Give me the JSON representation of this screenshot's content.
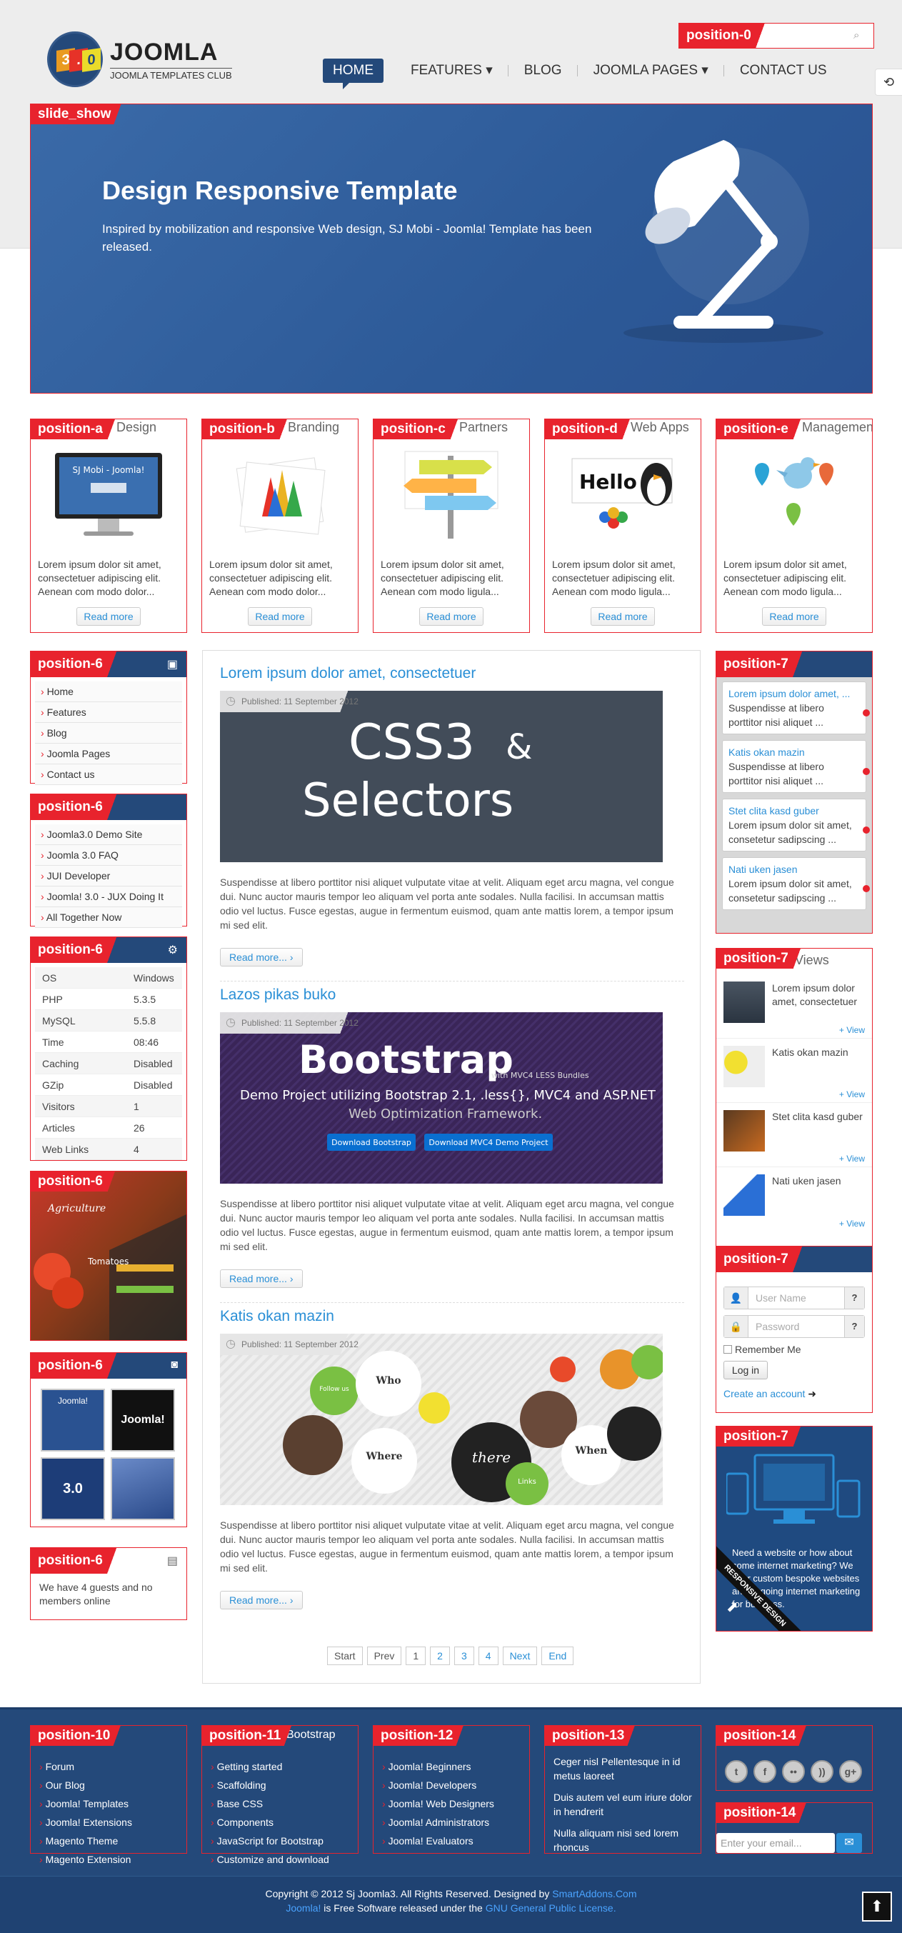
{
  "logo": {
    "cube_digits": [
      "3",
      ".",
      "0"
    ],
    "name": "JOOMLA",
    "tagline": "JOOMLA TEMPLATES CLUB"
  },
  "search": {
    "label": "position-0",
    "placeholder": ""
  },
  "nav": {
    "items": [
      "HOME",
      "FEATURES ▾",
      "BLOG",
      "JOOMLA PAGES ▾",
      "CONTACT US"
    ],
    "active": "HOME"
  },
  "slideshow": {
    "label": "slide_show",
    "title": "Design Responsive Template",
    "description": "Inspired by mobilization and responsive Web design, SJ Mobi - Joomla! Template has been released."
  },
  "features": [
    {
      "label": "position-a",
      "heading": "Design",
      "text": "Lorem ipsum dolor sit amet, consectetuer adipiscing elit. Aenean com modo dolor...",
      "button": "Read more",
      "screen_text": "SJ Mobi - Joomla!"
    },
    {
      "label": "position-b",
      "heading": "Branding",
      "text": "Lorem ipsum dolor sit amet, consectetuer adipiscing elit. Aenean com modo dolor...",
      "button": "Read more"
    },
    {
      "label": "position-c",
      "heading": "Partners",
      "text": "Lorem ipsum dolor sit amet, consectetuer adipiscing elit. Aenean com modo ligula...",
      "button": "Read more"
    },
    {
      "label": "position-d",
      "heading": "Web Apps",
      "text": "Lorem ipsum dolor sit amet, consectetuer adipiscing elit. Aenean com modo ligula...",
      "button": "Read more",
      "sign_text": "Hello"
    },
    {
      "label": "position-e",
      "heading": "Management",
      "text": "Lorem ipsum dolor sit amet, consectetuer adipiscing elit. Aenean com modo ligula...",
      "button": "Read more"
    }
  ],
  "left": {
    "menu1": {
      "label": "position-6",
      "items": [
        "Home",
        "Features",
        "Blog",
        "Joomla Pages",
        "Contact us"
      ]
    },
    "menu2": {
      "label": "position-6",
      "items": [
        "Joomla3.0 Demo Site",
        "Joomla 3.0 FAQ",
        "JUI Developer",
        "Joomla! 3.0 - JUX Doing It",
        "All Together Now"
      ]
    },
    "stats": {
      "label": "position-6",
      "rows": [
        [
          "OS",
          "Windows"
        ],
        [
          "PHP",
          "5.3.5"
        ],
        [
          "MySQL",
          "5.5.8"
        ],
        [
          "Time",
          "08:46"
        ],
        [
          "Caching",
          "Disabled"
        ],
        [
          "GZip",
          "Disabled"
        ],
        [
          "Visitors",
          "1"
        ],
        [
          "Articles",
          "26"
        ],
        [
          "Web Links",
          "4"
        ]
      ]
    },
    "banner": {
      "label": "position-6",
      "brand": "Agriculture",
      "sign": "Tomatoes"
    },
    "gallery": {
      "label": "position-6",
      "captions": [
        "Joomla!",
        "Joomla!",
        "3.0",
        ""
      ]
    },
    "online": {
      "label": "position-6",
      "text": "We have 4 guests and no members online"
    }
  },
  "articles": [
    {
      "title": "Lorem ipsum dolor amet, consectetuer",
      "published": "Published: 11 September 2012",
      "image_text": [
        "CSS3",
        "&",
        "Selectors"
      ],
      "text": "Suspendisse at libero porttitor nisi aliquet vulputate vitae at velit. Aliquam eget arcu magna, vel congue dui. Nunc auctor mauris tempor leo aliquam vel porta ante sodales. Nulla facilisi. In accumsan mattis odio vel luctus. Fusce egestas, augue in fermentum euismod, quam ante mattis lorem, a tempor ipsum mi sed elit.",
      "readmore": "Read more..."
    },
    {
      "title": "Lazos pikas buko",
      "published": "Published: 11 September 2012",
      "image_text": [
        "Bootstrap",
        "with MVC4 LESS Bundles",
        "Demo Project utilizing Bootstrap 2.1, .less{}, MVC4 and ASP.NET",
        "Web Optimization Framework.",
        "Download Bootstrap",
        "Download MVC4 Demo Project"
      ],
      "text": "Suspendisse at libero porttitor nisi aliquet vulputate vitae at velit. Aliquam eget arcu magna, vel congue dui. Nunc auctor mauris tempor leo aliquam vel porta ante sodales. Nulla facilisi. In accumsan mattis odio vel luctus. Fusce egestas, augue in fermentum euismod, quam ante mattis lorem, a tempor ipsum mi sed elit.",
      "readmore": "Read more..."
    },
    {
      "title": "Katis okan mazin",
      "published": "Published: 11 September 2012",
      "image_text": [
        "Who",
        "Where",
        "When",
        "there",
        "Links",
        "Follow us"
      ],
      "text": "Suspendisse at libero porttitor nisi aliquet vulputate vitae at velit. Aliquam eget arcu magna, vel congue dui. Nunc auctor mauris tempor leo aliquam vel porta ante sodales. Nulla facilisi. In accumsan mattis odio vel luctus. Fusce egestas, augue in fermentum euismod, quam ante mattis lorem, a tempor ipsum mi sed elit.",
      "readmore": "Read more..."
    }
  ],
  "pager": [
    "Start",
    "Prev",
    "1",
    "2",
    "3",
    "4",
    "Next",
    "End"
  ],
  "right": {
    "slider": {
      "label": "position-7",
      "items": [
        {
          "title": "Lorem ipsum dolor amet, ...",
          "text": "Suspendisse at libero porttitor nisi aliquet ..."
        },
        {
          "title": "Katis okan mazin",
          "text": "Suspendisse at libero porttitor nisi aliquet ..."
        },
        {
          "title": "Stet clita kasd guber",
          "text": "Lorem ipsum dolor sit amet, consetetur sadipscing ..."
        },
        {
          "title": "Nati uken jasen",
          "text": "Lorem ipsum dolor sit amet, consetetur sadipscing ..."
        }
      ]
    },
    "news": {
      "label": "position-7",
      "heading": "Views",
      "items": [
        {
          "title": "Lorem ipsum dolor amet, consectetuer",
          "view": "+ View"
        },
        {
          "title": "Katis okan mazin",
          "view": "+ View"
        },
        {
          "title": "Stet clita kasd guber",
          "view": "+ View"
        },
        {
          "title": "Nati uken jasen",
          "view": "+ View"
        }
      ]
    },
    "login": {
      "label": "position-7",
      "username_placeholder": "User Name",
      "password_placeholder": "Password",
      "remember": "Remember Me",
      "button": "Log in",
      "create": "Create an account"
    },
    "promo": {
      "label": "position-7",
      "text": "Need a website or how about some internet marketing? We offer custom bespoke websites and ongoing internet marketing for business.",
      "ribbon": "RESPONSIVE DESIGN"
    }
  },
  "footer": {
    "col1": {
      "label": "position-10",
      "items": [
        "Forum",
        "Our Blog",
        "Joomla! Templates",
        "Joomla! Extensions",
        "Magento Theme",
        "Magento Extension"
      ]
    },
    "col2": {
      "label": "position-11",
      "heading": "Bootstrap",
      "items": [
        "Getting started",
        "Scaffolding",
        "Base CSS",
        "Components",
        "JavaScript for Bootstrap",
        "Customize and download"
      ]
    },
    "col3": {
      "label": "position-12",
      "items": [
        "Joomla! Beginners",
        "Joomla! Developers",
        "Joomla! Web Designers",
        "Joomla! Administrators",
        "Joomla! Evaluators"
      ]
    },
    "col4": {
      "label": "position-13",
      "texts": [
        "Ceger nisl Pellentesque in id metus laoreet",
        "Duis autem vel eum iriure dolor in hendrerit",
        "Nulla aliquam nisi sed lorem rhoncus"
      ]
    },
    "col5": {
      "label": "position-14",
      "social": [
        "t",
        "f",
        "••",
        "))",
        "g+"
      ]
    },
    "newsletter": {
      "label": "position-14",
      "placeholder": "Enter your email..."
    }
  },
  "copyright": {
    "line1_pre": "Copyright © 2012 Sj Joomla3. All Rights Reserved. Designed by",
    "line1_link": "SmartAddons.Com",
    "line2_link1": "Joomla!",
    "line2_mid": "is Free Software released under the",
    "line2_link2": "GNU General Public License."
  },
  "colors": {
    "accent": "#e8232d",
    "brand": "#24497a",
    "link": "#2a8fd6"
  }
}
